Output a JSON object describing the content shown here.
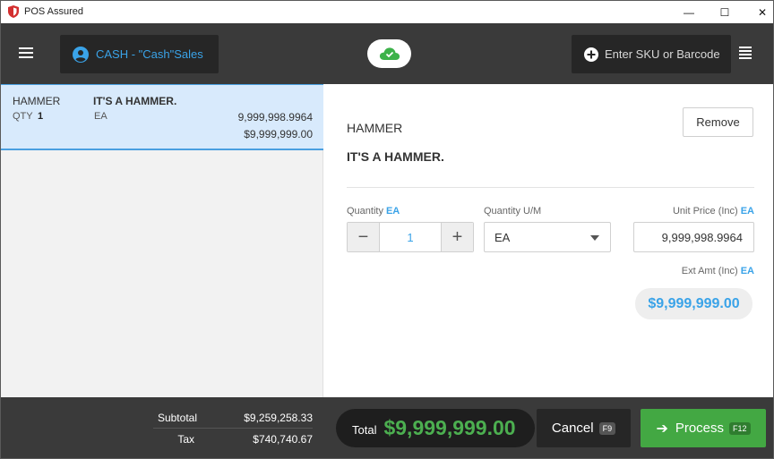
{
  "window": {
    "title": "POS Assured",
    "minimize_glyph": "—",
    "maximize_glyph": "☐",
    "close_glyph": "✕"
  },
  "toolbar": {
    "customer_label": "CASH - \"Cash\"Sales",
    "sku_placeholder": "Enter SKU or Barcode",
    "sync_status": "cloud-check-icon"
  },
  "cart": {
    "items": [
      {
        "name": "HAMMER",
        "description": "IT'S A HAMMER.",
        "qty_label": "QTY",
        "qty": "1",
        "uom": "EA",
        "unit_price": "9,999,998.9964",
        "ext_amount": "$9,999,999.00",
        "selected": true
      }
    ]
  },
  "detail": {
    "name": "HAMMER",
    "description": "IT'S A HAMMER.",
    "remove_label": "Remove",
    "quantity_label": "Quantity",
    "quantity_uom": "EA",
    "quantity_value": "1",
    "decrement_glyph": "−",
    "increment_glyph": "+",
    "uom_label": "Quantity U/M",
    "uom_value": "EA",
    "unit_price_label": "Unit Price (Inc)",
    "unit_price_uom": "EA",
    "unit_price_value": "9,999,998.9964",
    "ext_amt_label": "Ext Amt (Inc)",
    "ext_amt_uom": "EA",
    "ext_amt_value": "$9,999,999.00"
  },
  "footer": {
    "subtotal_label": "Subtotal",
    "subtotal_value": "$9,259,258.33",
    "tax_label": "Tax",
    "tax_value": "$740,740.67",
    "total_label": "Total",
    "total_value": "$9,999,999.00",
    "cancel_label": "Cancel",
    "cancel_key": "F9",
    "process_label": "Process",
    "process_key": "F12"
  },
  "colors": {
    "accent_blue": "#3aa3e8",
    "total_green": "#4caf50",
    "process_green": "#43a843",
    "toolbar_dark": "#3a3a3a",
    "selected_row": "#d8eafc"
  }
}
